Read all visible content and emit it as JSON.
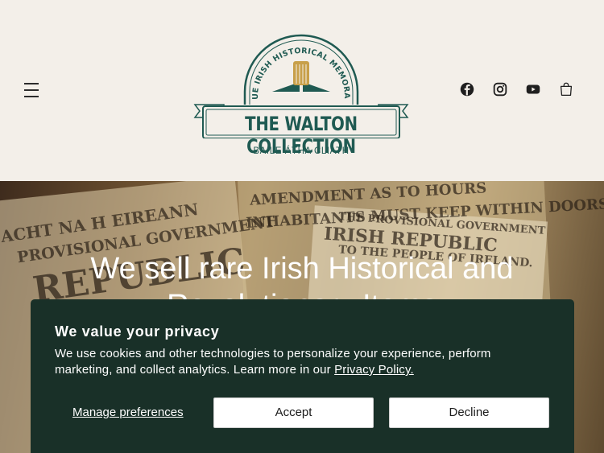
{
  "header": {
    "menu_icon": "hamburger-menu-icon",
    "logo": {
      "arc_text": "UNIQUE IRISH HISTORICAL MEMORABILIA",
      "title": "THE WALTON COLLECTION",
      "subtitle": "BAILE ÁTHA CLIATH",
      "brand_color": "#1f5a52"
    },
    "social": [
      {
        "icon": "facebook-icon"
      },
      {
        "icon": "instagram-icon"
      },
      {
        "icon": "youtube-icon"
      }
    ],
    "cart_icon": "cart-icon"
  },
  "hero": {
    "heading_line1": "We sell rare Irish Historical and",
    "heading_line2": "Revolutionary Items"
  },
  "cookie_banner": {
    "title": "We value your privacy",
    "text": "We use cookies and other technologies to personalize your experience, perform marketing, and collect analytics. Learn more in our ",
    "link": "Privacy Policy.",
    "manage_label": "Manage preferences",
    "accept_label": "Accept",
    "decline_label": "Decline",
    "background_color": "#193028"
  }
}
